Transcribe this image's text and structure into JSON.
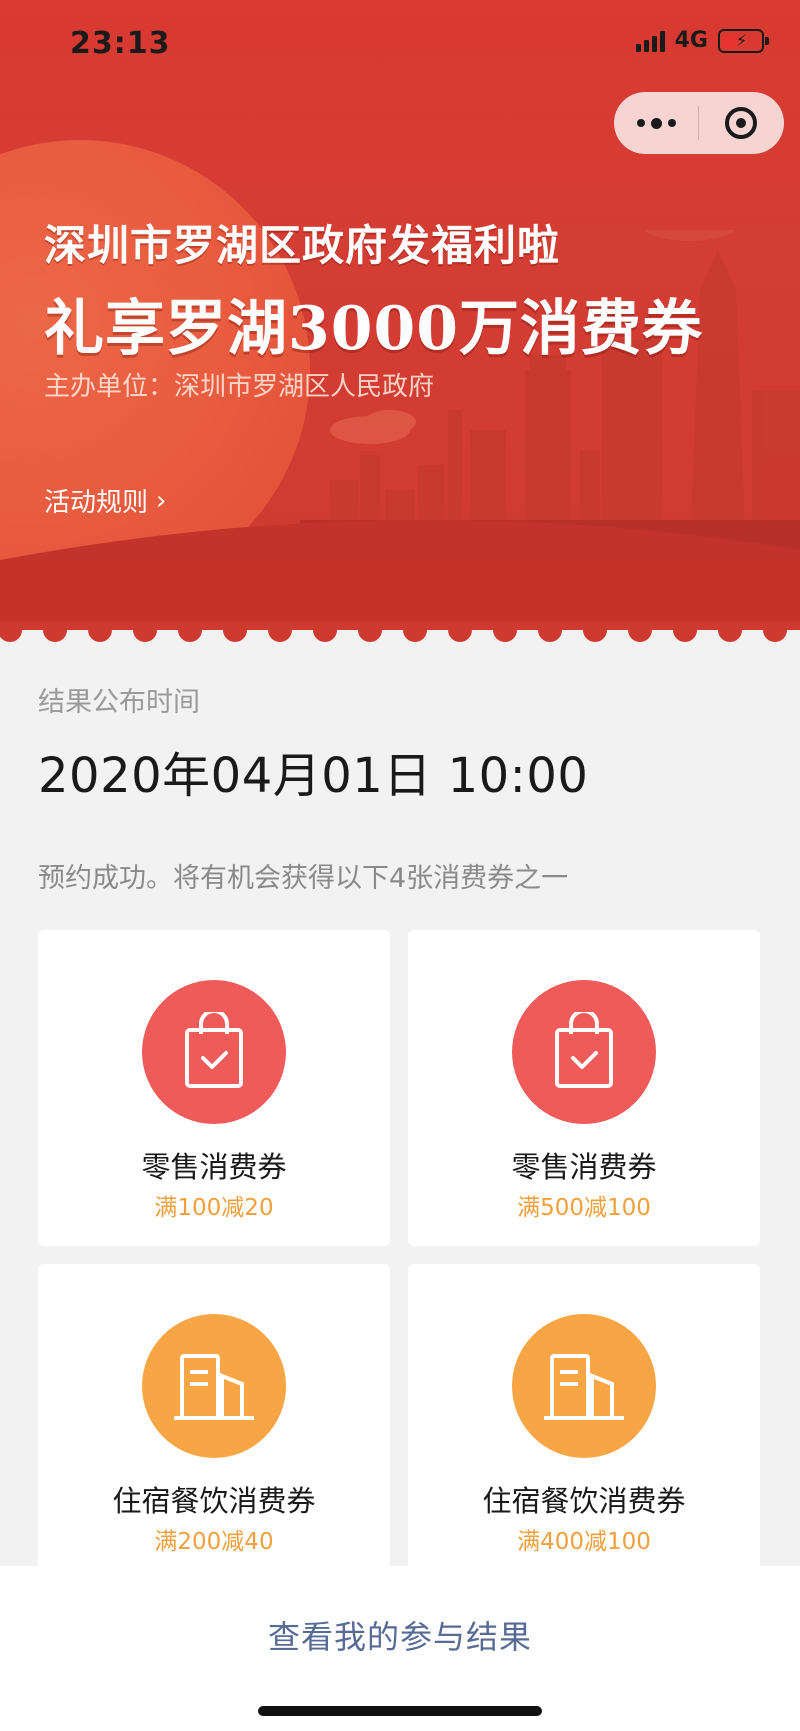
{
  "status_bar": {
    "time": "23:13",
    "network": "4G"
  },
  "banner": {
    "title_line1": "深圳市罗湖区政府发福利啦",
    "title_line2": "礼享罗湖3000万消费券",
    "organizer": "主办单位：深圳市罗湖区人民政府",
    "rules_link": "活动规则",
    "rules_chevron": "›"
  },
  "result": {
    "label": "结果公布时间",
    "datetime": "2020年04月01日 10:00"
  },
  "notice": "预约成功。将有机会获得以下4张消费券之一",
  "coupons": [
    {
      "name": "零售消费券",
      "condition": "满100减20",
      "icon": "shopping-bag-icon",
      "color": "#ee5b59"
    },
    {
      "name": "零售消费券",
      "condition": "满500减100",
      "icon": "shopping-bag-icon",
      "color": "#ee5b59"
    },
    {
      "name": "住宿餐饮消费券",
      "condition": "满200减40",
      "icon": "building-icon",
      "color": "#f8a545"
    },
    {
      "name": "住宿餐饮消费券",
      "condition": "满400减100",
      "icon": "building-icon",
      "color": "#f8a545"
    }
  ],
  "footer": {
    "button_label": "查看我的参与结果"
  },
  "colors": {
    "banner_red": "#d93a32",
    "link_blue": "#576b95",
    "accent_orange": "#f0a03c"
  }
}
